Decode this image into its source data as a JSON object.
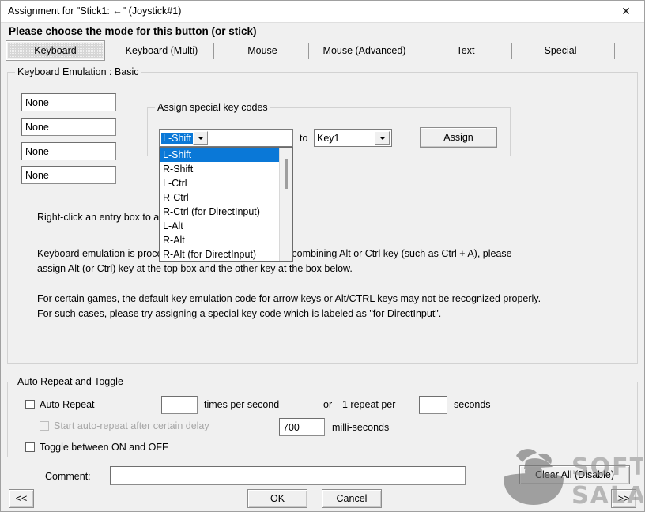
{
  "window": {
    "title": "Assignment for \"Stick1: ←\" (Joystick#1)",
    "close_label": "✕"
  },
  "heading": "Please choose the mode for this button (or stick)",
  "tabs": [
    {
      "label": "Keyboard",
      "selected": true
    },
    {
      "label": "Keyboard (Multi)",
      "selected": false
    },
    {
      "label": "Mouse",
      "selected": false
    },
    {
      "label": "Mouse (Advanced)",
      "selected": false
    },
    {
      "label": "Text",
      "selected": false
    },
    {
      "label": "Special",
      "selected": false
    }
  ],
  "keyboard_group": {
    "title": "Keyboard Emulation : Basic",
    "entries": [
      {
        "value": "None"
      },
      {
        "value": "None"
      },
      {
        "value": "None"
      },
      {
        "value": "None"
      }
    ],
    "help_text_1": "Right-click an entry box to assign special keys.",
    "help_text_2": "Keyboard emulation is processed from top to bottom.  For combining Alt or Ctrl key (such as Ctrl + A), please\nassign Alt (or Ctrl) key at the top box and the other key at the box below.",
    "help_text_3": "For certain games, the default key emulation code for arrow keys or Alt/CTRL keys may not be recognized properly.\nFor such cases, please try assigning a special key code which is labeled as \"for DirectInput\"."
  },
  "special_keys_group": {
    "title": "Assign special key codes",
    "source_combo": {
      "value": "L-Shift",
      "open": true,
      "options": [
        "L-Shift",
        "R-Shift",
        "L-Ctrl",
        "R-Ctrl",
        "R-Ctrl (for DirectInput)",
        "L-Alt",
        "R-Alt",
        "R-Alt (for DirectInput)"
      ],
      "selected_index": 0
    },
    "to_label": "to",
    "target_combo": {
      "value": "Key1"
    },
    "assign_button": "Assign"
  },
  "auto_repeat_group": {
    "title": "Auto Repeat and Toggle",
    "auto_repeat_checkbox": {
      "label": "Auto Repeat",
      "checked": false
    },
    "rate_value": "",
    "times_per_second_label": "times per second",
    "or_label": "or",
    "one_repeat_per_label": "1 repeat per",
    "seconds_value": "",
    "seconds_label": "seconds",
    "delay_checkbox": {
      "label": "Start auto-repeat after certain delay",
      "checked": false,
      "disabled": true
    },
    "delay_value": "700",
    "milliseconds_label": "milli-seconds",
    "toggle_checkbox": {
      "label": "Toggle between ON and OFF",
      "checked": false
    }
  },
  "footer": {
    "comment_label": "Comment:",
    "comment_value": "",
    "comment_placeholder": "",
    "clear_all_button": "Clear All (Disable)",
    "prev_button": "<<",
    "next_button": ">>",
    "ok_button": "OK",
    "cancel_button": "Cancel"
  },
  "watermark": {
    "line1": "SOFT",
    "line2": "SALAD"
  },
  "colors": {
    "accent": "#0a78d7",
    "face": "#f0f0f0",
    "field": "#ffffff",
    "border": "#d2d2d2",
    "disabled_text": "#a6a6a6"
  }
}
